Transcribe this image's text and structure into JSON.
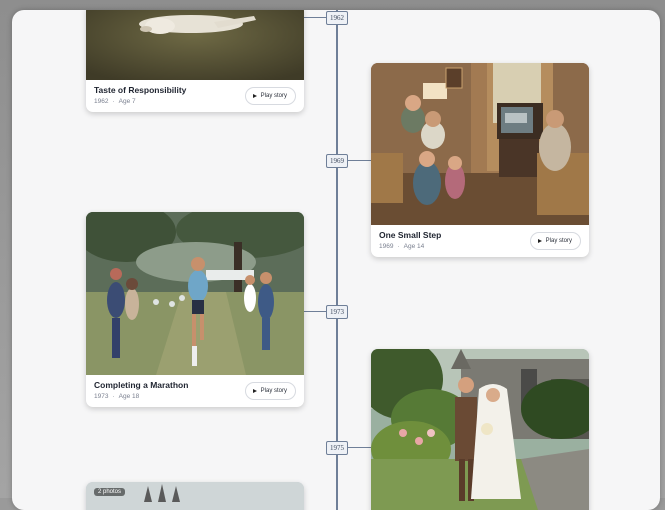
{
  "timeline": {
    "markers": [
      {
        "year": "1962"
      },
      {
        "year": "1969"
      },
      {
        "year": "1973"
      },
      {
        "year": "1975"
      }
    ]
  },
  "cards": [
    {
      "title": "Taste of Responsibility",
      "year": "1962",
      "age": "Age 7",
      "play_label": "Play story",
      "photo": "dog-on-lawn"
    },
    {
      "title": "One Small Step",
      "year": "1969",
      "age": "Age 14",
      "play_label": "Play story",
      "photo": "family-watching-moon-landing-tv"
    },
    {
      "title": "Completing a Marathon",
      "year": "1973",
      "age": "Age 18",
      "play_label": "Play story",
      "photo": "runner-finishing-race-in-park"
    },
    {
      "title": "",
      "year": "",
      "age": "",
      "play_label": "",
      "photo": "wedding-couple-by-church"
    },
    {
      "title": "",
      "year": "",
      "age": "",
      "play_label": "",
      "photo": "partial-card",
      "badge": "2 photos"
    }
  ],
  "colors": {
    "axis": "#6f7f98",
    "panel": "#f6f6f7"
  }
}
